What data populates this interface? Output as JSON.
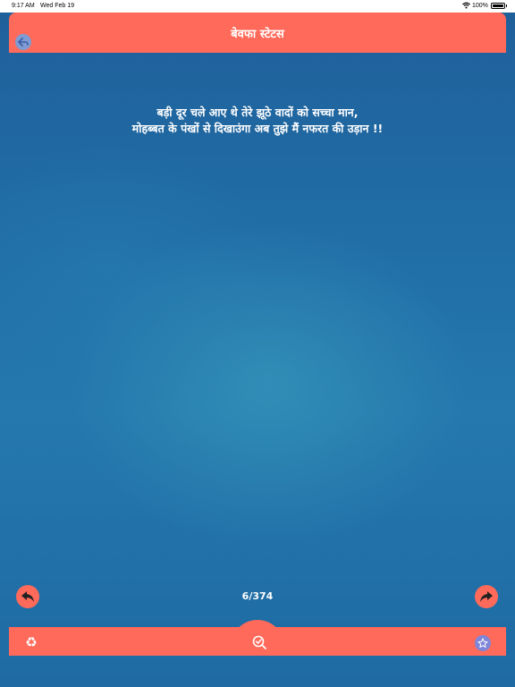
{
  "status_bar": {
    "time": "9:17 AM",
    "date": "Wed Feb 19",
    "battery": "100%"
  },
  "header": {
    "title": "बेवफा स्टेटस"
  },
  "quote": {
    "line1": "बड़ी दूर चले आए थे तेरे झूठे वादों को सच्चा मान,",
    "line2": "मोहब्बत के पंखों से दिखाउंगा अब तुझे मैं नफरत की उड़ान !!"
  },
  "pager": {
    "counter": "6/374"
  },
  "colors": {
    "accent": "#ff6a5a",
    "background": "#1e6aa0",
    "icon_circle": "#7f9bd2"
  },
  "icons": {
    "back": "back-arrow-icon",
    "previous": "reply-arrow-icon",
    "next": "forward-arrow-icon",
    "share": "recycle-icon",
    "search": "search-icon",
    "favorite": "star-icon"
  }
}
